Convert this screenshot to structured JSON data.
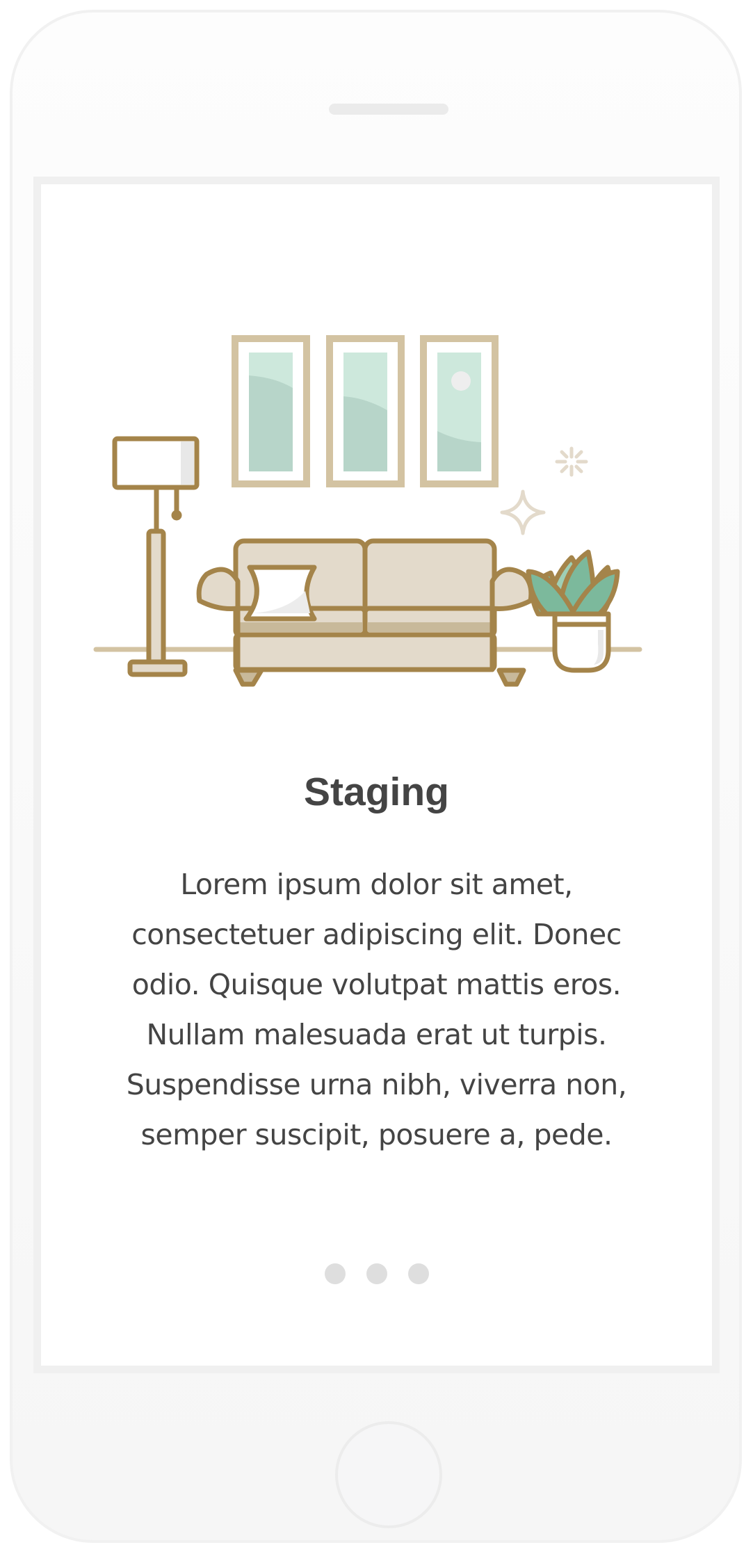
{
  "onboarding": {
    "title": "Staging",
    "description": "Lorem ipsum dolor sit amet, consectetuer adipiscing elit. Donec odio. Quisque volutpat mattis eros. Nullam malesuada erat ut turpis. Suspendisse urna nibh, viverra non, semper suscipit, posuere a, pede.",
    "illustration": "living-room-staging-illustration",
    "pagination": {
      "total": 3
    }
  },
  "colors": {
    "outline": "#a4844a",
    "frame": "#d3c3a2",
    "sofa": "#e3dacb",
    "cushion": "#c8b99a",
    "art_glass": "#cde8dc",
    "art_shade": "#b7d5c9",
    "leaf": "#7cb99c",
    "text": "#444444",
    "dot": "#dedede"
  }
}
